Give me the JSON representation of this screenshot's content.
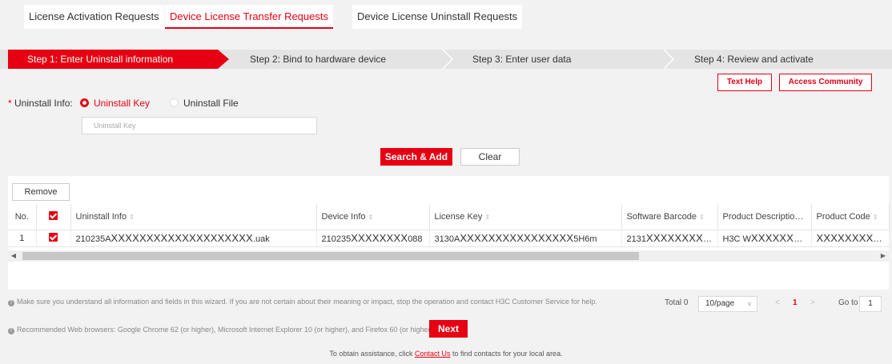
{
  "tabs": [
    {
      "label": "License Activation Requests",
      "active": false
    },
    {
      "label": "Device License Transfer Requests",
      "active": true
    },
    {
      "label": "Device License Uninstall Requests",
      "active": false
    }
  ],
  "steps": [
    "Step 1: Enter Uninstall information",
    "Step 2: Bind to hardware device",
    "Step 3: Enter user data",
    "Step 4: Review and activate"
  ],
  "help": {
    "text_help": "Text Help",
    "access_community": "Access Community"
  },
  "uninstall": {
    "required_mark": "*",
    "label": "Uninstall Info:",
    "option_key": "Uninstall Key",
    "option_file": "Uninstall File",
    "selected": "Uninstall Key",
    "key_placeholder": "Uninstall Key",
    "key_value": ""
  },
  "actions": {
    "search_add": "Search & Add",
    "clear": "Clear",
    "remove": "Remove",
    "next": "Next"
  },
  "table": {
    "columns": [
      "No.",
      "",
      "Uninstall Info",
      "Device Info",
      "License Key",
      "Software Barcode",
      "Product Description",
      "Product Code"
    ],
    "sort_icon": "⇕",
    "rows": [
      {
        "no": "1",
        "checked": true,
        "uninstall_prefix": "210235A",
        "uninstall_mask": "XXXXXXXXXXXXXXXXXXXX",
        "uninstall_suffix": ".uak",
        "device_prefix": "210235",
        "device_mask": "XXXXXXXX",
        "device_suffix": "088",
        "license_prefix": "3130A",
        "license_mask": "XXXXXXXXXXXXXXXX",
        "license_suffix": "5H6m",
        "barcode_prefix": "2131",
        "barcode_mask": "XXXXXXXX…",
        "desc_prefix": "H3C W",
        "desc_mask": "XXXXXXXXX…",
        "code_mask": "XXXXXXXX…"
      }
    ]
  },
  "notes": {
    "note1": "Make sure you understand all information and fields in this wizard. If you are not certain about their meaning or impact, stop the operation and contact H3C Customer Service for help.",
    "note2": "Recommended Web browsers: Google Chrome 62 (or higher), Microsoft Internet Explorer 10 (or higher), and Firefox 60 (or higher)."
  },
  "pagination": {
    "total": "Total 0",
    "page_size": "10/page",
    "current_page": "1",
    "goto_label": "Go to",
    "goto_value": "1"
  },
  "footer": {
    "before": "To obtain assistance, click ",
    "link": "Contact Us",
    "after": " to find contacts for your local area."
  },
  "colors": {
    "accent": "#e60012",
    "step_bar": "#e4e4e4",
    "background": "#f2f2f2"
  }
}
